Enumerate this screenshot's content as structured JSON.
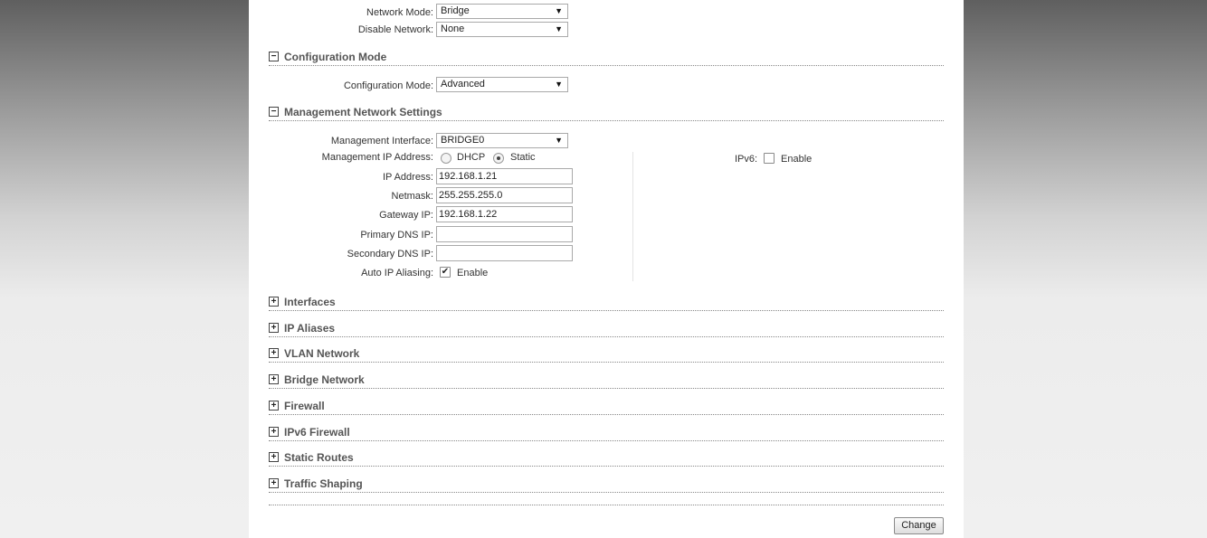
{
  "network": {
    "mode_label": "Network Mode:",
    "mode_value": "Bridge",
    "disable_label": "Disable Network:",
    "disable_value": "None"
  },
  "config_section": {
    "title": "Configuration Mode",
    "toggle": "−",
    "mode_label": "Configuration Mode:",
    "mode_value": "Advanced"
  },
  "mgmt_section": {
    "title": "Management Network Settings",
    "toggle": "−",
    "interface_label": "Management Interface:",
    "interface_value": "BRIDGE0",
    "ip_mode_label": "Management IP Address:",
    "dhcp_label": "DHCP",
    "static_label": "Static",
    "ip_mode_selected": "Static",
    "ip_label": "IP Address:",
    "ip_value": "192.168.1.21",
    "netmask_label": "Netmask:",
    "netmask_value": "255.255.255.0",
    "gateway_label": "Gateway IP:",
    "gateway_value": "192.168.1.22",
    "primary_dns_label": "Primary DNS IP:",
    "primary_dns_value": "",
    "secondary_dns_label": "Secondary DNS IP:",
    "secondary_dns_value": "",
    "aliasing_label": "Auto IP Aliasing:",
    "aliasing_enable_label": "Enable",
    "aliasing_checked": true,
    "ipv6_label": "IPv6:",
    "ipv6_enable_label": "Enable",
    "ipv6_checked": false
  },
  "collapsed_sections": [
    {
      "title": "Interfaces",
      "toggle": "+"
    },
    {
      "title": "IP Aliases",
      "toggle": "+"
    },
    {
      "title": "VLAN Network",
      "toggle": "+"
    },
    {
      "title": "Bridge Network",
      "toggle": "+"
    },
    {
      "title": "Firewall",
      "toggle": "+"
    },
    {
      "title": "IPv6 Firewall",
      "toggle": "+"
    },
    {
      "title": "Static Routes",
      "toggle": "+"
    },
    {
      "title": "Traffic Shaping",
      "toggle": "+"
    }
  ],
  "actions": {
    "change_label": "Change"
  },
  "icons": {
    "dropdown": "chevron-down-icon",
    "collapse": "minus-box-icon",
    "expand": "plus-box-icon"
  }
}
